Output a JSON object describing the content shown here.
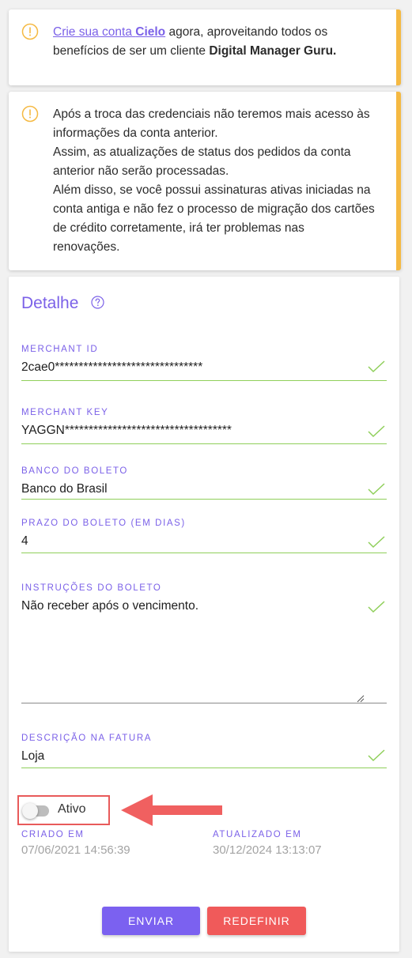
{
  "alerts": {
    "first": {
      "link_text": "Crie sua conta ",
      "link_bold": "Cielo",
      "text_after_link": " agora, aproveitando todos os",
      "line2_prefix": "benefícios de ser um cliente ",
      "line2_bold": "Digital Manager Guru."
    },
    "second": {
      "lines": [
        "Após a troca das credenciais não teremos mais acesso às",
        "informações da conta anterior.",
        "Assim, as atualizações de status dos pedidos da conta",
        "anterior não serão processadas.",
        "Além disso, se você possui assinaturas ativas iniciadas na",
        "conta antiga e não fez o processo de migração dos cartões",
        "de crédito corretamente, irá ter problemas nas",
        "renovações."
      ]
    }
  },
  "card": {
    "title": "Detalhe",
    "fields": {
      "merchant_id": {
        "label": "MERCHANT ID",
        "value": "2cae0*******************************"
      },
      "merchant_key": {
        "label": "MERCHANT KEY",
        "value": "YAGGN***********************************"
      },
      "banco_boleto": {
        "label": "BANCO DO BOLETO",
        "value": "Banco do Brasil"
      },
      "prazo_boleto": {
        "label": "PRAZO DO BOLETO (EM DIAS)",
        "value": "4"
      },
      "instrucoes_boleto": {
        "label": "INSTRUÇÕES DO BOLETO",
        "value": "Não receber após o vencimento."
      },
      "descricao_fatura": {
        "label": "DESCRIÇÃO NA FATURA",
        "value": "Loja"
      }
    },
    "toggle": {
      "label": "Ativo",
      "on": false
    },
    "meta": {
      "created_label": "CRIADO EM",
      "created_value": "07/06/2021 14:56:39",
      "updated_label": "ATUALIZADO EM",
      "updated_value": "30/12/2024 13:13:07"
    },
    "buttons": {
      "send": "ENVIAR",
      "reset": "REDEFINIR"
    }
  },
  "colors": {
    "accent": "#7b61e8",
    "warning": "#f5b942",
    "valid": "#8fcf5a",
    "danger": "#f05a5a"
  },
  "icons": [
    "warning-icon",
    "help-icon",
    "check-icon",
    "red-arrow-annotation"
  ]
}
